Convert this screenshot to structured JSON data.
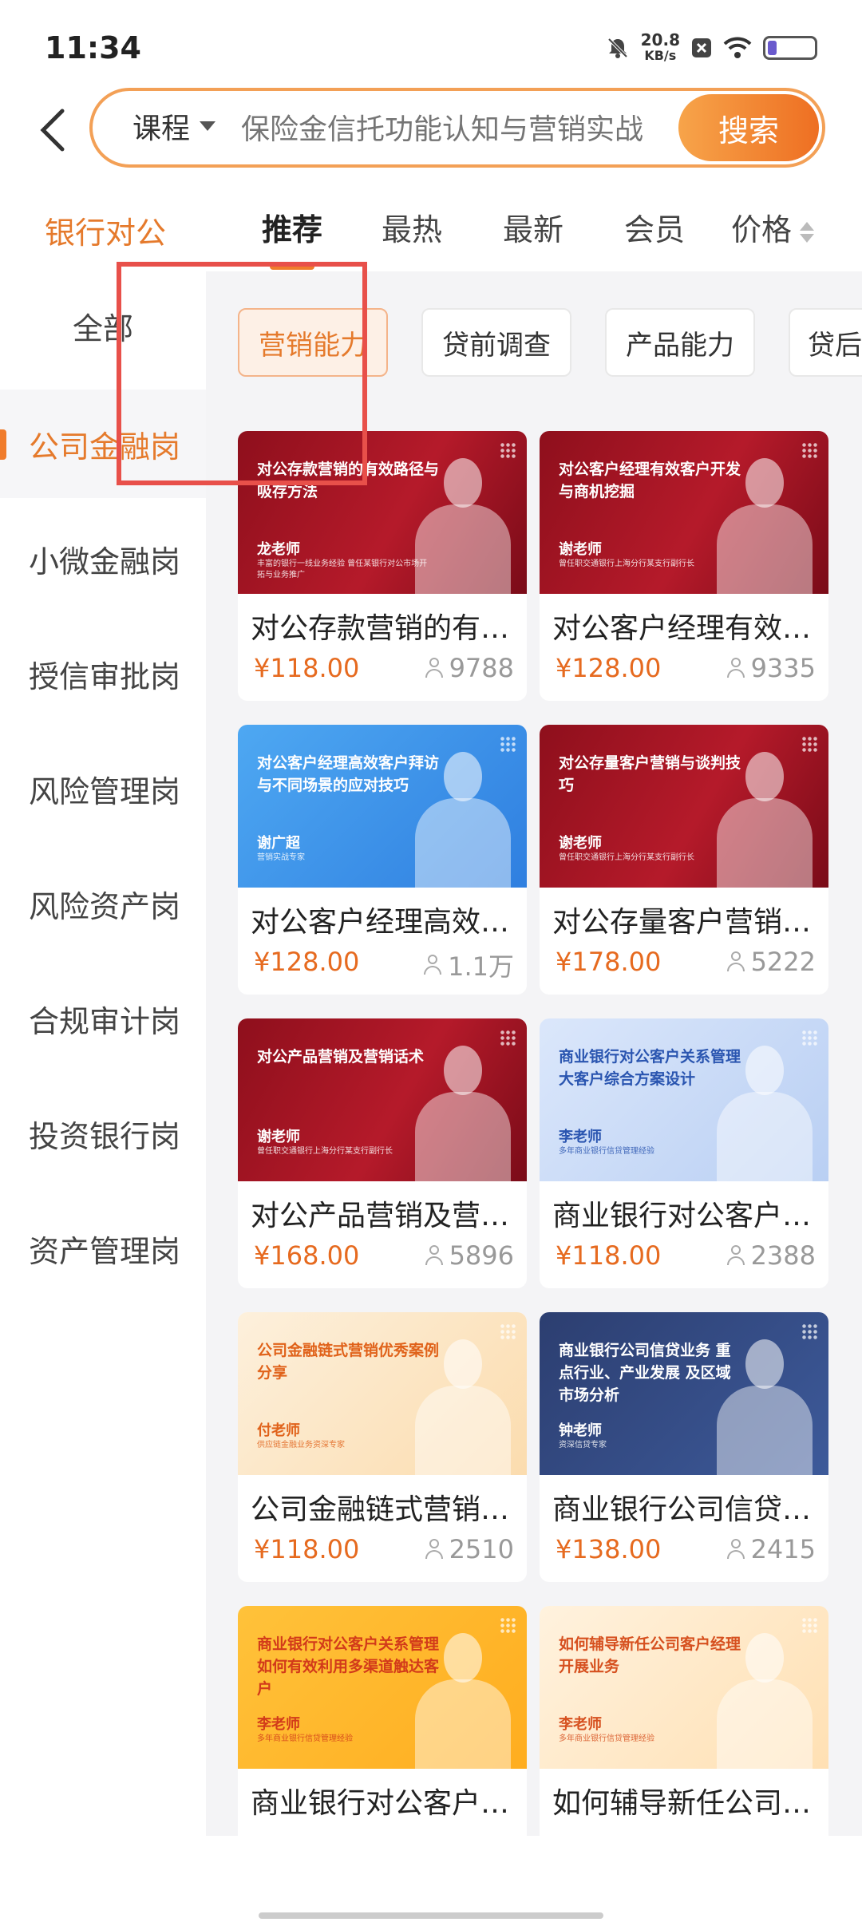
{
  "status_bar": {
    "time": "11:34",
    "net_speed_value": "20.8",
    "net_speed_unit": "KB/s",
    "icons": [
      "mute-icon",
      "notification-x-icon",
      "wifi-icon",
      "battery-icon"
    ],
    "battery_level": 0.2
  },
  "search": {
    "scope_label": "课程",
    "placeholder": "保险金信托功能认知与营销实战",
    "button_label": "搜索"
  },
  "top_nav": {
    "category_label": "银行对公",
    "tabs": [
      "推荐",
      "最热",
      "最新",
      "会员",
      "价格"
    ],
    "active_tab": "推荐"
  },
  "sidebar": {
    "items": [
      "全部",
      "公司金融岗",
      "小微金融岗",
      "授信审批岗",
      "风险管理岗",
      "风险资产岗",
      "合规审计岗",
      "投资银行岗",
      "资产管理岗"
    ],
    "active": "公司金融岗"
  },
  "chips": {
    "items": [
      "营销能力",
      "贷前调查",
      "产品能力",
      "贷后"
    ],
    "active": "营销能力"
  },
  "courses": [
    {
      "title": "对公存款营销的有效路径与吸存方法",
      "price": "¥118.00",
      "count": "9788",
      "thumb_title": "对公存款营销的有效路径与吸存方法",
      "thumb_teacher": "龙老师",
      "thumb_desc": "丰富的银行一线业务经验 曾任某银行对公市场开拓与业务推广",
      "theme": "red"
    },
    {
      "title": "对公客户经理有效客户开发与商机挖掘",
      "price": "¥128.00",
      "count": "9335",
      "thumb_title": "对公客户经理有效客户开发与商机挖掘",
      "thumb_teacher": "谢老师",
      "thumb_desc": "曾任职交通银行上海分行某支行副行长",
      "theme": "red"
    },
    {
      "title": "对公客户经理高效客户拜访与不同场景的应对技巧",
      "price": "¥128.00",
      "count": "1.1万",
      "thumb_title": "对公客户经理高效客户拜访与不同场景的应对技巧",
      "thumb_teacher": "谢广超",
      "thumb_desc": "营销实战专家",
      "theme": "blue"
    },
    {
      "title": "对公存量客户营销与谈判技巧",
      "price": "¥178.00",
      "count": "5222",
      "thumb_title": "对公存量客户营销与谈判技巧",
      "thumb_teacher": "谢老师",
      "thumb_desc": "曾任职交通银行上海分行某支行副行长",
      "theme": "red"
    },
    {
      "title": "对公产品营销及营销话术",
      "price": "¥168.00",
      "count": "5896",
      "thumb_title": "对公产品营销及营销话术",
      "thumb_teacher": "谢老师",
      "thumb_desc": "曾任职交通银行上海分行某支行副行长",
      "theme": "red"
    },
    {
      "title": "商业银行对公客户关系管理大客户综合方案设计",
      "price": "¥118.00",
      "count": "2388",
      "thumb_title": "商业银行对公客户关系管理 大客户综合方案设计",
      "thumb_teacher": "李老师",
      "thumb_desc": "多年商业银行信贷管理经验",
      "theme": "lightblue"
    },
    {
      "title": "公司金融链式营销优秀案例分享",
      "price": "¥118.00",
      "count": "2510",
      "thumb_title": "公司金融链式营销优秀案例分享",
      "thumb_teacher": "付老师",
      "thumb_desc": "供应链金融业务资深专家",
      "theme": "orange"
    },
    {
      "title": "商业银行公司信贷业务重点行业、产业发展及区域市场分析",
      "price": "¥138.00",
      "count": "2415",
      "thumb_title": "商业银行公司信贷业务 重点行业、产业发展 及区域市场分析",
      "thumb_teacher": "钟老师",
      "thumb_desc": "资深信贷专家",
      "theme": "navy"
    },
    {
      "title": "商业银行对公客户关系管理如何有效利用多渠道触达客户",
      "price": "",
      "count": "",
      "thumb_title": "商业银行对公客户关系管理 如何有效利用多渠道触达客户",
      "thumb_teacher": "李老师",
      "thumb_desc": "多年商业银行信贷管理经验",
      "theme": "yellow"
    },
    {
      "title": "如何辅导新任公司客户经理开展业务",
      "price": "",
      "count": "",
      "thumb_title": "如何辅导新任公司客户经理开展业务",
      "thumb_teacher": "李老师",
      "thumb_desc": "多年商业银行信贷管理经验",
      "theme": "peach"
    }
  ]
}
